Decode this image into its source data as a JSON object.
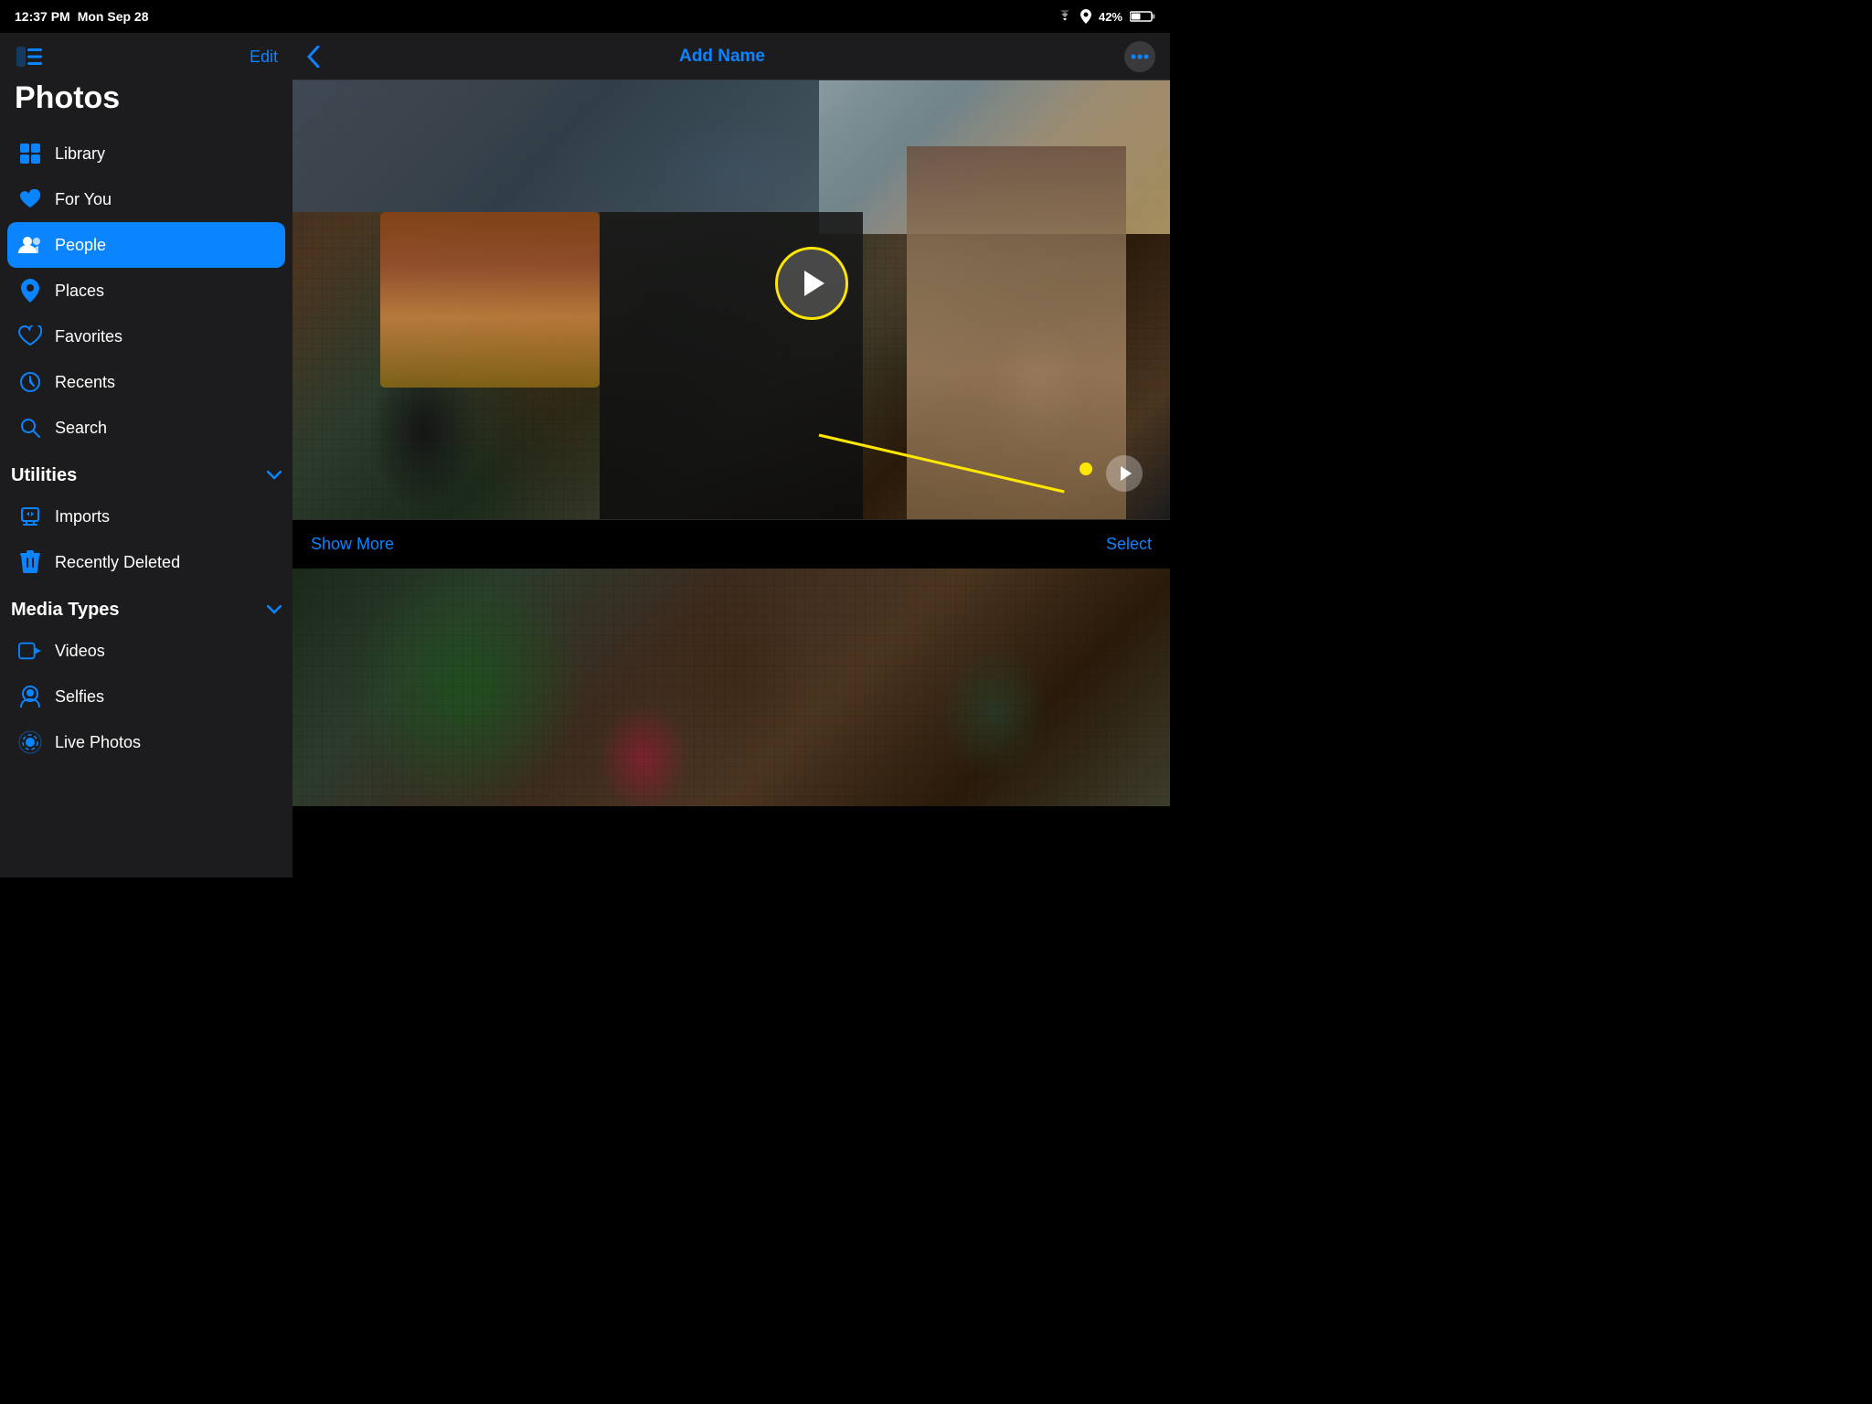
{
  "statusBar": {
    "time": "12:37 PM",
    "date": "Mon Sep 28",
    "wifi": "wifi-icon",
    "signal": "signal-icon",
    "battery": "42%"
  },
  "sidebar": {
    "toggle_icon": "sidebar-toggle-icon",
    "edit_label": "Edit",
    "app_title": "Photos",
    "nav_items": [
      {
        "id": "library",
        "label": "Library",
        "icon": "library-icon",
        "active": false
      },
      {
        "id": "for-you",
        "label": "For You",
        "icon": "for-you-icon",
        "active": false
      },
      {
        "id": "people",
        "label": "People",
        "icon": "people-icon",
        "active": true
      },
      {
        "id": "places",
        "label": "Places",
        "icon": "places-icon",
        "active": false
      },
      {
        "id": "favorites",
        "label": "Favorites",
        "icon": "favorites-icon",
        "active": false
      },
      {
        "id": "recents",
        "label": "Recents",
        "icon": "recents-icon",
        "active": false
      },
      {
        "id": "search",
        "label": "Search",
        "icon": "search-icon",
        "active": false
      }
    ],
    "utilities": {
      "section_title": "Utilities",
      "expanded": true,
      "items": [
        {
          "id": "imports",
          "label": "Imports",
          "icon": "imports-icon"
        },
        {
          "id": "recently-deleted",
          "label": "Recently Deleted",
          "icon": "trash-icon"
        }
      ]
    },
    "media_types": {
      "section_title": "Media Types",
      "expanded": true,
      "items": [
        {
          "id": "videos",
          "label": "Videos",
          "icon": "videos-icon"
        },
        {
          "id": "selfies",
          "label": "Selfies",
          "icon": "selfies-icon"
        },
        {
          "id": "live-photos",
          "label": "Live Photos",
          "icon": "live-photos-icon"
        }
      ]
    }
  },
  "topNav": {
    "back_icon": "chevron-left-icon",
    "title": "Add Name",
    "more_icon": "more-options-icon"
  },
  "content": {
    "show_more_label": "Show More",
    "select_label": "Select"
  }
}
